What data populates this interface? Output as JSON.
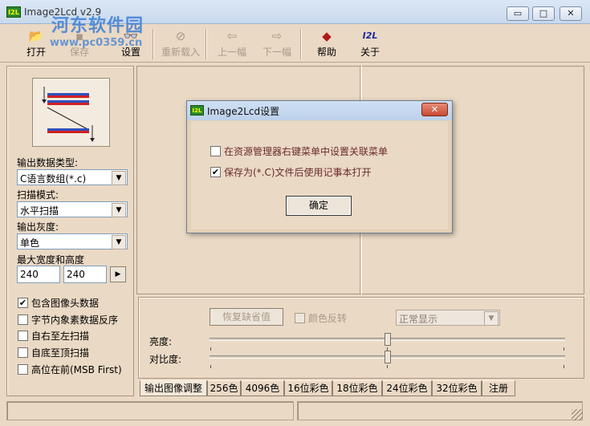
{
  "window": {
    "title": "Image2Lcd v2.9",
    "app_icon": "I2L",
    "controls": {
      "minimize": "▭",
      "maximize": "□",
      "close": "✕"
    }
  },
  "watermark": {
    "text": "河东软件园",
    "url": "www.pc0359.cn"
  },
  "toolbar": {
    "open": "打开",
    "save": "保存",
    "settings": "设置",
    "reload": "重新载入",
    "prev": "上一幅",
    "next": "下一幅",
    "help": "帮助",
    "about": "关于",
    "about_icon": "I2L"
  },
  "left": {
    "output_type_label": "输出数据类型:",
    "output_type_value": "C语言数组(*.c)",
    "scan_mode_label": "扫描模式:",
    "scan_mode_value": "水平扫描",
    "gray_label": "输出灰度:",
    "gray_value": "单色",
    "size_label": "最大宽度和高度",
    "width": "240",
    "height": "240",
    "options": [
      {
        "label": "包含图像头数据",
        "checked": true
      },
      {
        "label": "字节内象素数据反序",
        "checked": false
      },
      {
        "label": "自右至左扫描",
        "checked": false
      },
      {
        "label": "自底至顶扫描",
        "checked": false
      },
      {
        "label": "高位在前(MSB First)",
        "checked": false
      }
    ]
  },
  "bottom": {
    "restore_button": "恢复缺省值",
    "invert_label": "颜色反转",
    "display_value": "正常显示",
    "brightness_label": "亮度:",
    "contrast_label": "对比度:",
    "brightness_level": 0.5,
    "contrast_level": 0.5
  },
  "tabs": [
    "输出图像调整",
    "256色",
    "4096色",
    "16位彩色",
    "18位彩色",
    "24位彩色",
    "32位彩色",
    "注册"
  ],
  "dialog": {
    "title": "Image2Lcd设置",
    "option1": "在资源管理器右键菜单中设置关联菜单",
    "option1_checked": false,
    "option2": "保存为(*.C)文件后使用记事本打开",
    "option2_checked": true,
    "ok": "确定"
  }
}
